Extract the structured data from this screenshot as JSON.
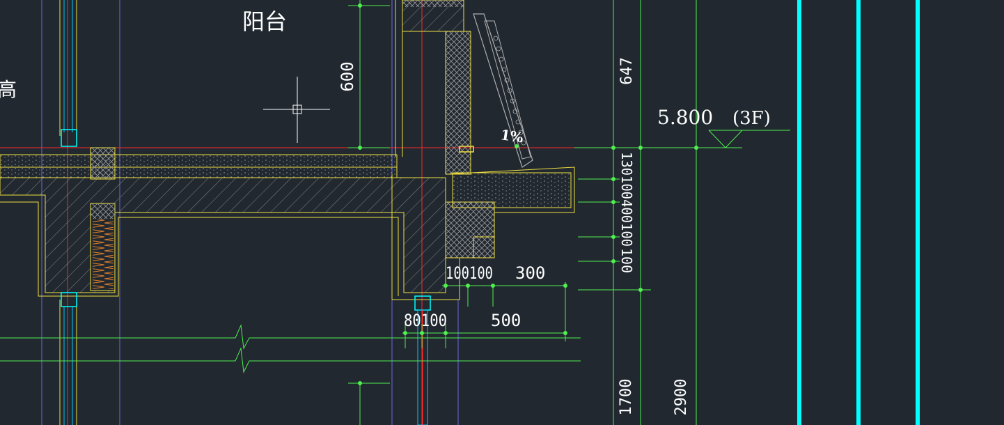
{
  "drawing": {
    "room_label": "阳台",
    "clipped_label": "高",
    "slope_label": "1%",
    "elevation": {
      "value": "5.800",
      "floor": "(3F)"
    },
    "dimensions": {
      "vertical_left": "600",
      "vertical_right_top": "647",
      "stack": "130100400100",
      "stack_tail": "100",
      "bottom_row_1": [
        "100100",
        "300"
      ],
      "bottom_row_2": [
        "80100",
        "500"
      ],
      "low_1": "1700",
      "low_2": "2900"
    }
  },
  "colors": {
    "background": "#212830",
    "dimension": "#4ff04f",
    "wall_outline": "#f0e040",
    "axis": "#ff2a2a",
    "grid_line": "#7a7af0",
    "cyan": "#00ffff",
    "hatch": "#9a9a9a",
    "insulation": "#e0802a"
  }
}
